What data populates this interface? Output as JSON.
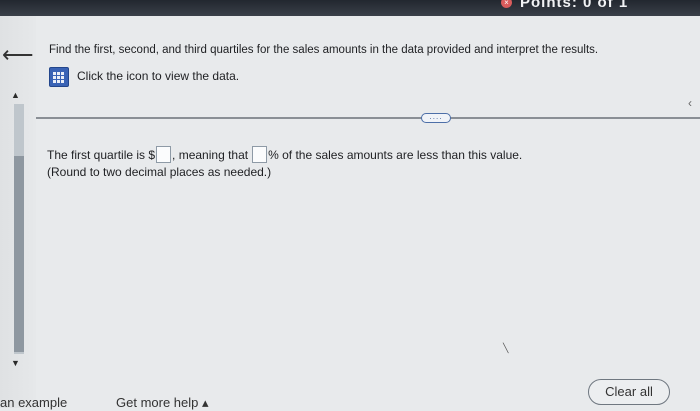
{
  "header": {
    "points_label": "Points: 0 of 1",
    "close_symbol": "×"
  },
  "nav": {
    "back_symbol": "⟵",
    "scroll_up_symbol": "▲",
    "scroll_down_symbol": "▼"
  },
  "question": {
    "text": "Find the first, second, and third quartiles for the sales amounts in the data provided and interpret the results.",
    "data_link_text": "Click the icon to view the data."
  },
  "more_button": "....",
  "answer": {
    "part1": "The first quartile is $",
    "part2": ", meaning that",
    "part3": "% of the sales amounts are less than this value.",
    "box1_value": "",
    "box2_value": "",
    "round_note": "(Round to two decimal places as needed.)"
  },
  "footer": {
    "example_label": "an example",
    "help_label": "Get more help ▴",
    "clear_label": "Clear all"
  },
  "colors": {
    "accent": "#3a63b5",
    "background": "#e8eaec"
  }
}
